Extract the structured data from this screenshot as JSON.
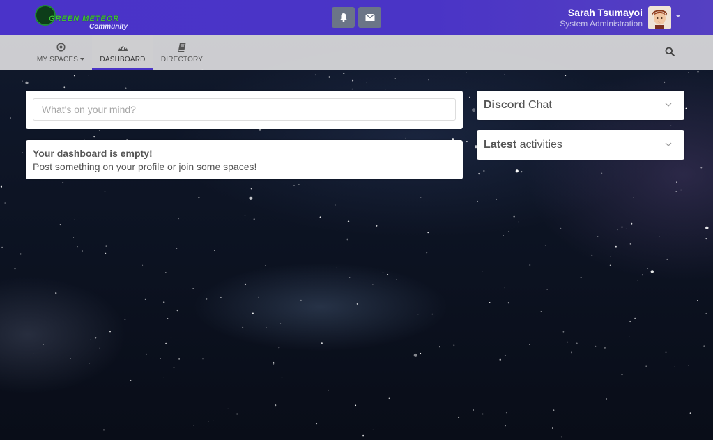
{
  "brand": {
    "logo_text": "GREEN METEOR",
    "logo_subtitle": "Community"
  },
  "header": {
    "notifications_icon": "bell-icon",
    "messages_icon": "envelope-icon",
    "user_name": "Sarah Tsumayoi",
    "user_role": "System Administration"
  },
  "nav": {
    "items": [
      {
        "label": "MY SPACES",
        "icon": "dot-circle-icon",
        "active": false
      },
      {
        "label": "DASHBOARD",
        "icon": "tachometer-icon",
        "active": true
      },
      {
        "label": "DIRECTORY",
        "icon": "book-icon",
        "active": false
      }
    ],
    "search_icon": "search-icon"
  },
  "post": {
    "placeholder": "What's on your mind?"
  },
  "empty": {
    "title": "Your dashboard is empty!",
    "text": "Post something on your profile or join some spaces!"
  },
  "widgets": [
    {
      "bold": "Discord",
      "rest": "Chat"
    },
    {
      "bold": "Latest",
      "rest": "activities"
    }
  ],
  "colors": {
    "header": "#4a34c6",
    "accent_underline": "#4a34c6",
    "nav_bg": "#dcdcde"
  }
}
